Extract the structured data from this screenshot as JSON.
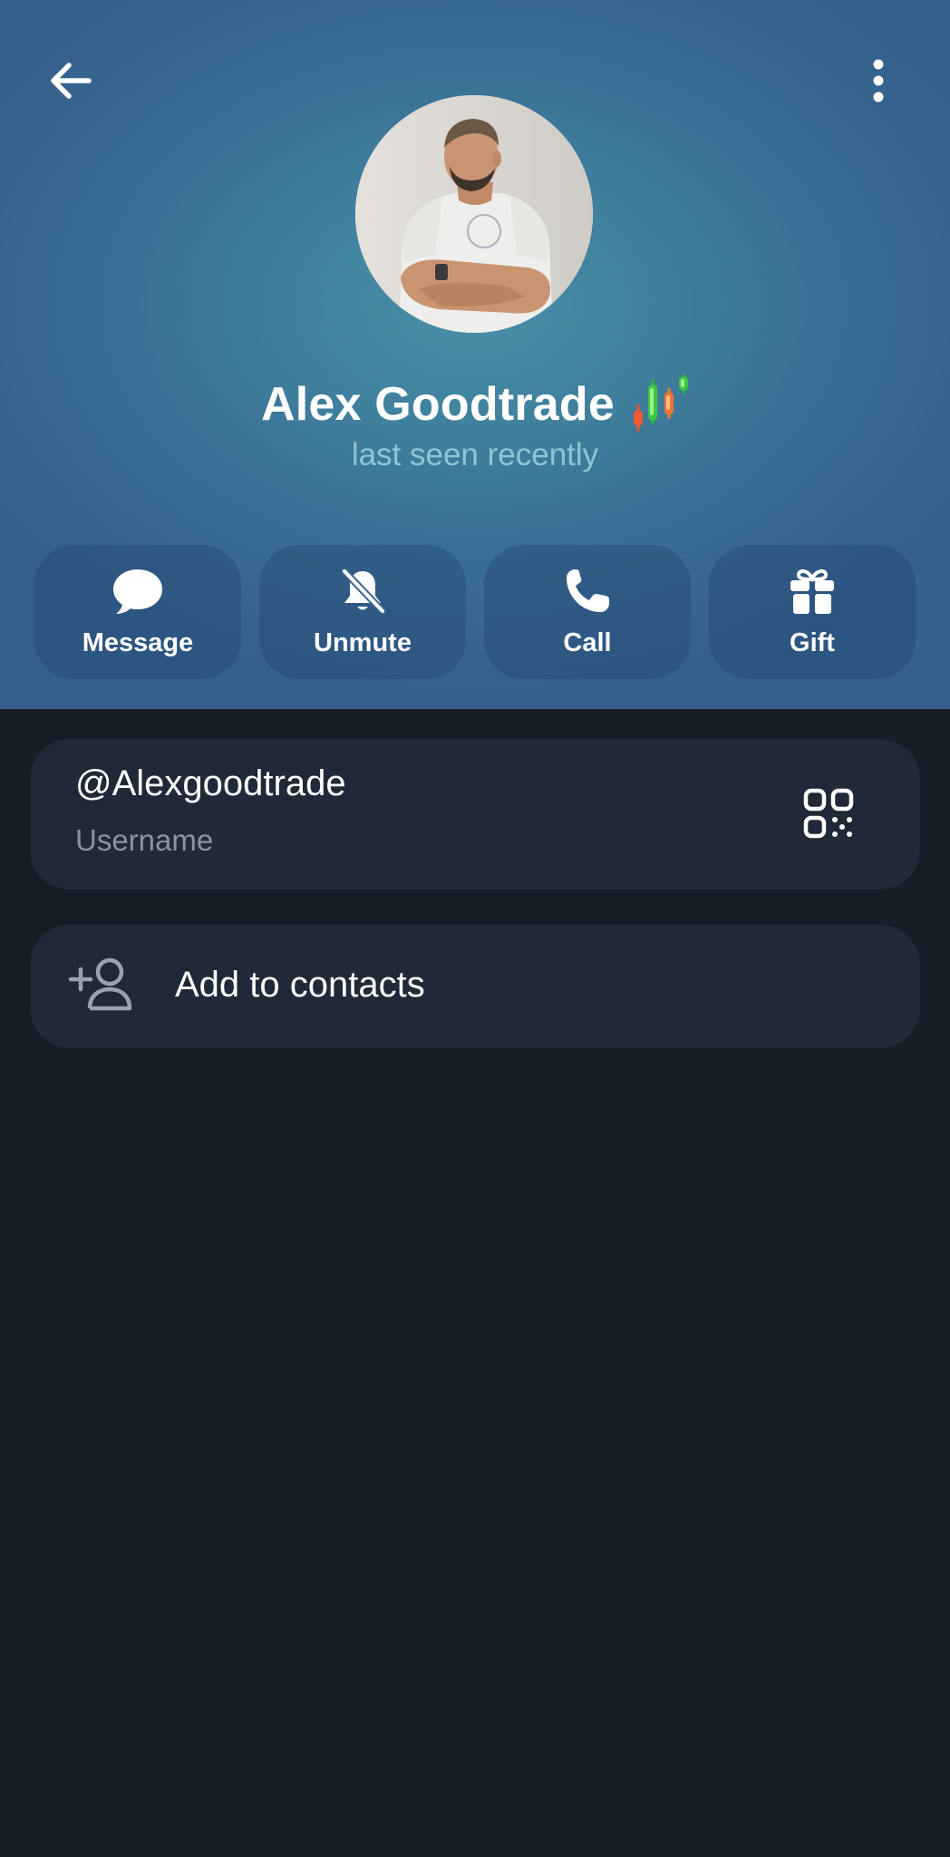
{
  "profile": {
    "name": "Alex Goodtrade",
    "status": "last seen recently",
    "emoji_status_icon": "candlestick-chart-emoji"
  },
  "header": {
    "back_icon": "arrow-left-icon",
    "menu_icon": "more-vertical-icon"
  },
  "actions": [
    {
      "label": "Message",
      "icon": "chat-bubble-icon"
    },
    {
      "label": "Unmute",
      "icon": "bell-off-icon"
    },
    {
      "label": "Call",
      "icon": "phone-icon"
    },
    {
      "label": "Gift",
      "icon": "gift-icon"
    }
  ],
  "username": {
    "value": "@Alexgoodtrade",
    "caption": "Username",
    "qr_icon": "qr-code-icon"
  },
  "contacts": {
    "label": "Add to contacts",
    "icon": "add-user-icon"
  },
  "colors": {
    "header_gradient_center": "#4a8fa8",
    "header_gradient_edge": "#355f8c",
    "background": "#171d27",
    "card": "#1f2937",
    "status_text": "#8fc4d6",
    "caption_text": "#8a939e"
  }
}
